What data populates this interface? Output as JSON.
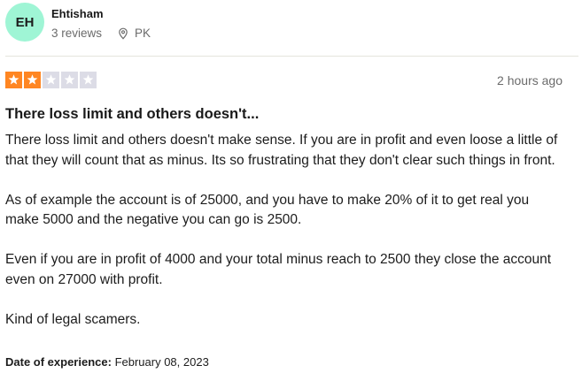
{
  "reviewer": {
    "initials": "EH",
    "name": "Ehtisham",
    "reviews": "3 reviews",
    "country": "PK",
    "avatar_color": "#9ff5d5"
  },
  "review": {
    "rating": 2,
    "max_rating": 5,
    "star_filled_color": "#ff8622",
    "star_empty_color": "#dcdce6",
    "time": "2 hours ago",
    "title": "There loss limit and others doesn't...",
    "paragraphs": [
      "There loss limit and others doesn't make sense. If you are in profit and even loose a little of that they will count that as minus. Its so frustrating that they don't clear such things in front.",
      "As of example the account is of 25000, and you have to make 20% of it to get real you make 5000 and the negative you can go is 2500.",
      "Even if you are in profit of 4000 and your total minus reach to 2500 they close the account even on 27000 with profit.",
      "Kind of legal scamers."
    ],
    "experience_label": "Date of experience:",
    "experience_date": "February 08, 2023"
  },
  "icons": {
    "location": "location-pin-icon",
    "star": "star-icon"
  }
}
